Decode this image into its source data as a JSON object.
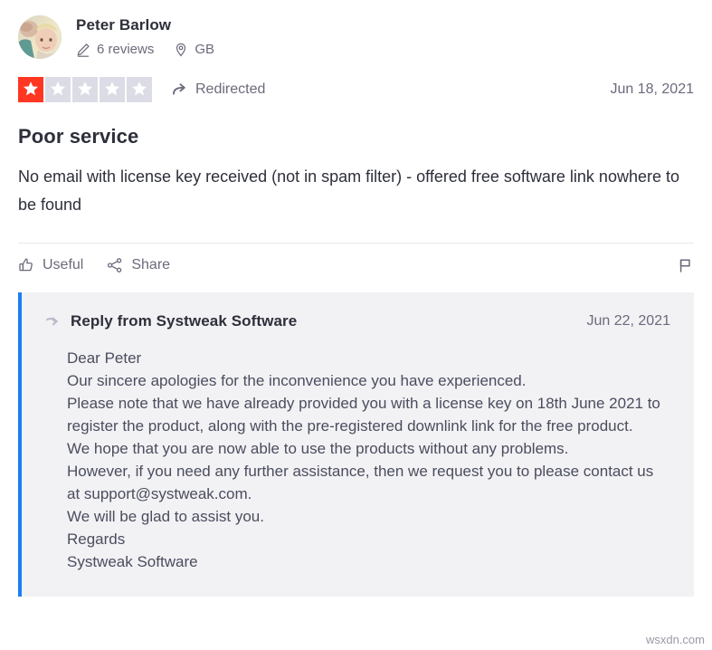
{
  "consumer": {
    "name": "Peter Barlow",
    "avatar_icon": "user-photo-avatar",
    "reviews_count_label": "6 reviews",
    "reviews_icon": "pencil-icon",
    "location_label": "GB",
    "location_icon": "map-pin-icon"
  },
  "rating": {
    "value": 1,
    "max": 5,
    "active_color": "#ff3722",
    "inactive_color": "#dcdce6",
    "redirected_label": "Redirected",
    "redirected_icon": "curved-arrow-icon"
  },
  "review": {
    "date": "Jun 18, 2021",
    "title": "Poor service",
    "body": "No email with license key received (not in spam filter) - offered free software link nowhere to be found"
  },
  "actions": {
    "useful_label": "Useful",
    "useful_icon": "thumbs-up-icon",
    "share_label": "Share",
    "share_icon": "share-nodes-icon",
    "flag_icon": "flag-icon"
  },
  "reply": {
    "title": "Reply from Systweak Software",
    "date": "Jun 22, 2021",
    "arrow_icon": "reply-arrow-icon",
    "accent_color": "#1b7ef3",
    "background_color": "#f2f2f5",
    "lines": [
      "Dear Peter",
      "Our sincere apologies for the inconvenience you have experienced.",
      "Please note that we have already provided you with a license key on 18th June 2021 to register the product, along with the pre-registered downlink link for the free product.",
      "We hope that you are now able to use the products without any problems.",
      "However, if you need any further assistance, then we request you to please contact us at support@systweak.com.",
      "We will be glad to assist you.",
      "Regards",
      "Systweak Software"
    ]
  },
  "watermark": {
    "text": "wsxdn.com"
  }
}
